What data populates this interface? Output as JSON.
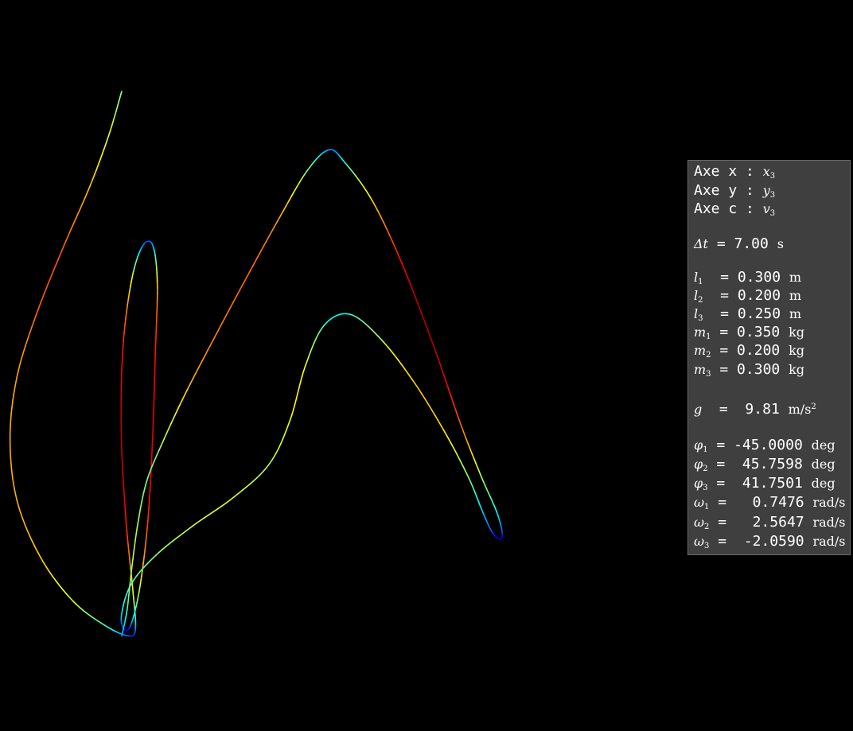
{
  "panel": {
    "axes": [
      {
        "label": "Axe x : ",
        "sym": "x",
        "sub": "3"
      },
      {
        "label": "Axe y : ",
        "sym": "y",
        "sub": "3"
      },
      {
        "label": "Axe c : ",
        "sym": "v",
        "sub": "3"
      }
    ],
    "dt": {
      "sym": "Δt",
      "eq": " = 7.00 ",
      "unit": "s"
    },
    "params": [
      {
        "sym": "l",
        "sub": "1",
        "eq": "  = 0.300 ",
        "unit": "m"
      },
      {
        "sym": "l",
        "sub": "2",
        "eq": "  = 0.200 ",
        "unit": "m"
      },
      {
        "sym": "l",
        "sub": "3",
        "eq": "  = 0.250 ",
        "unit": "m"
      },
      {
        "sym": "m",
        "sub": "1",
        "eq": " = 0.350 ",
        "unit": "kg"
      },
      {
        "sym": "m",
        "sub": "2",
        "eq": " = 0.200 ",
        "unit": "kg"
      },
      {
        "sym": "m",
        "sub": "3",
        "eq": " = 0.300 ",
        "unit": "kg"
      }
    ],
    "gravity": {
      "sym": "g",
      "eq": "  =  9.81 ",
      "unit": "m/s",
      "unit_sup": "2"
    },
    "state": [
      {
        "sym": "φ",
        "sub": "1",
        "eq": " = -45.0000 ",
        "unit": "deg"
      },
      {
        "sym": "φ",
        "sub": "2",
        "eq": " =  45.7598 ",
        "unit": "deg"
      },
      {
        "sym": "φ",
        "sub": "3",
        "eq": " =  41.7501 ",
        "unit": "deg"
      },
      {
        "sym": "ω",
        "sub": "1",
        "eq": " =   0.7476 ",
        "unit": "rad/s"
      },
      {
        "sym": "ω",
        "sub": "2",
        "eq": " =   2.5647 ",
        "unit": "rad/s"
      },
      {
        "sym": "ω",
        "sub": "3",
        "eq": " =  -2.0590 ",
        "unit": "rad/s"
      }
    ]
  },
  "chart_data": {
    "type": "line",
    "title": "",
    "xlabel": "",
    "ylabel": "",
    "grid": false,
    "colormap": "jet",
    "background": "#000000",
    "xlim": [
      -0.36,
      0.54
    ],
    "ylim": [
      -0.7,
      0.1
    ],
    "series": [
      {
        "x": [
          -0.2316,
          -0.2452,
          -0.2652,
          -0.293,
          -0.3216,
          -0.342,
          -0.3494,
          -0.342,
          -0.3172,
          -0.2828,
          -0.2468,
          -0.223,
          -0.217,
          -0.22,
          -0.227,
          -0.232,
          -0.2304,
          -0.2214,
          -0.21,
          -0.199,
          -0.194,
          -0.1962,
          -0.199,
          -0.204,
          -0.212,
          -0.2206,
          -0.2274,
          -0.232,
          -0.222,
          -0.1958,
          -0.1572,
          -0.1132,
          -0.076,
          -0.054,
          -0.038,
          -0.018,
          0.0094,
          0.0426,
          0.078,
          0.111,
          0.135,
          0.1484,
          0.158,
          0.1666,
          0.17,
          0.164,
          0.148,
          0.126,
          0.098,
          0.064,
          0.033,
          0.004,
          -0.013,
          -0.036,
          -0.065,
          -0.1,
          -0.134,
          -0.165,
          -0.1884,
          -0.205,
          -0.2144,
          -0.221,
          -0.226,
          -0.2316
        ],
        "y": [
          0.0,
          -0.048,
          -0.104,
          -0.17,
          -0.244,
          -0.312,
          -0.38,
          -0.448,
          -0.51,
          -0.558,
          -0.586,
          -0.596,
          -0.586,
          -0.544,
          -0.47,
          -0.376,
          -0.282,
          -0.208,
          -0.17,
          -0.168,
          -0.21,
          -0.29,
          -0.38,
          -0.47,
          -0.54,
          -0.58,
          -0.59,
          -0.575,
          -0.54,
          -0.508,
          -0.476,
          -0.444,
          -0.408,
          -0.36,
          -0.301,
          -0.256,
          -0.244,
          -0.272,
          -0.32,
          -0.376,
          -0.424,
          -0.458,
          -0.48,
          -0.49,
          -0.484,
          -0.46,
          -0.422,
          -0.364,
          -0.28,
          -0.188,
          -0.12,
          -0.078,
          -0.064,
          -0.087,
          -0.138,
          -0.204,
          -0.27,
          -0.332,
          -0.384,
          -0.426,
          -0.472,
          -0.522,
          -0.568,
          -0.596
        ]
      }
    ]
  }
}
